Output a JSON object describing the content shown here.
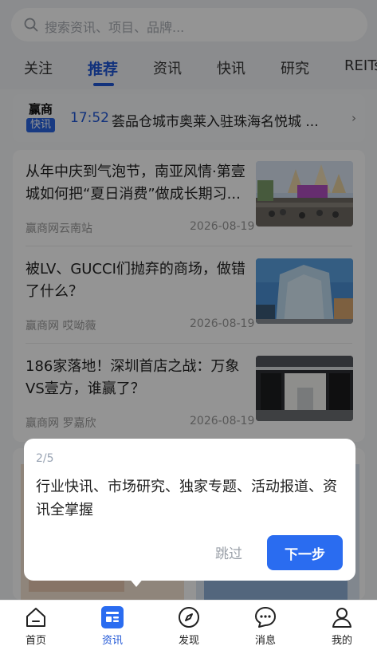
{
  "search": {
    "placeholder": "搜索资讯、项目、品牌..."
  },
  "tabs": [
    {
      "label": "关注"
    },
    {
      "label": "推荐",
      "active": true
    },
    {
      "label": "资讯"
    },
    {
      "label": "快讯"
    },
    {
      "label": "研究"
    },
    {
      "label": "REITs"
    }
  ],
  "flash": {
    "logo_top": "赢商",
    "logo_bottom": "快讯",
    "time": "17:52",
    "title": "荟品仓城市奥莱入驻珠海名悦城 ..."
  },
  "articles": [
    {
      "title": "从年中庆到气泡节，南亚风情·第壹城如何把“夏日消费”做成长期习...",
      "source": "赢商网云南站",
      "date": "2026-08-19"
    },
    {
      "title": "被LV、GUCCI们抛弃的商场，做错了什么？",
      "source": "赢商网 哎呦薇",
      "date": "2026-08-19"
    },
    {
      "title": "186家落地！深圳首店之战：万象VS壹方，谁赢了？",
      "source": "赢商网 罗嘉欣",
      "date": "2026-08-19"
    }
  ],
  "guide": {
    "step": "2/5",
    "text": "行业快讯、市场研究、独家专题、活动报道、资讯全掌握",
    "skip": "跳过",
    "next": "下一步"
  },
  "bottom_nav": [
    {
      "label": "首页",
      "icon": "home-icon"
    },
    {
      "label": "资讯",
      "icon": "news-icon",
      "active": true
    },
    {
      "label": "发现",
      "icon": "compass-icon"
    },
    {
      "label": "消息",
      "icon": "message-icon"
    },
    {
      "label": "我的",
      "icon": "profile-icon"
    }
  ],
  "colors": {
    "accent": "#1f56d6",
    "button": "#2a6cf0",
    "overlay": "rgba(0,0,0,0.42)"
  }
}
